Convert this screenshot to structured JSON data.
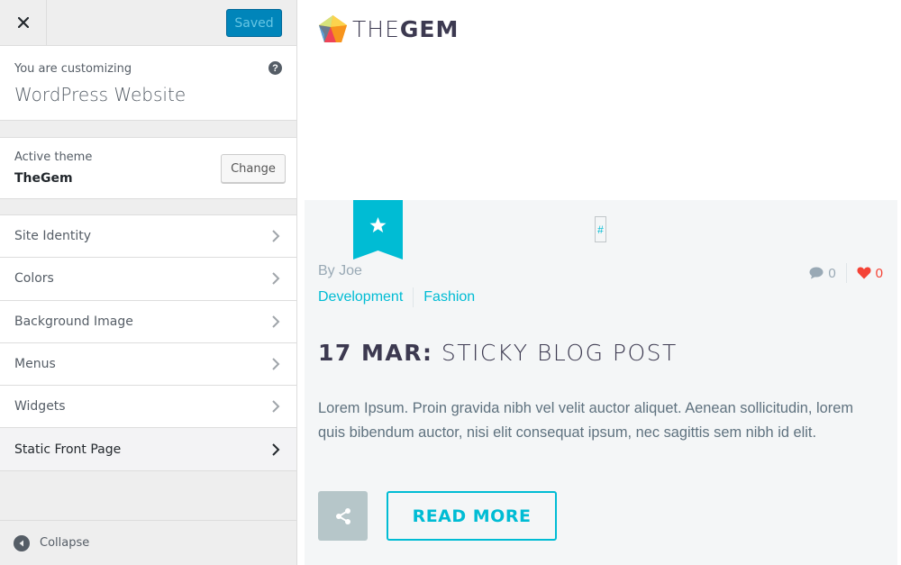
{
  "sidebar": {
    "header": {
      "close_icon": "close-icon",
      "saved_label": "Saved"
    },
    "info": {
      "customizing_label": "You are customizing",
      "site_name": "WordPress Website",
      "help_icon": "help-icon",
      "help_glyph": "?"
    },
    "theme": {
      "label": "Active theme",
      "name": "TheGem",
      "change_label": "Change"
    },
    "items": [
      {
        "label": "Site Identity"
      },
      {
        "label": "Colors"
      },
      {
        "label": "Background Image"
      },
      {
        "label": "Menus"
      },
      {
        "label": "Widgets"
      },
      {
        "label": "Static Front Page",
        "active": true
      }
    ],
    "footer": {
      "collapse_label": "Collapse"
    }
  },
  "preview": {
    "logo": {
      "thin": "THE",
      "bold": "GEM"
    },
    "post": {
      "hash_link": "#",
      "author": "By Joe",
      "categories": [
        "Development",
        "Fashion"
      ],
      "comments_count": "0",
      "likes_count": "0",
      "date": "17 MAR:",
      "title": "STICKY BLOG POST",
      "excerpt": "Lorem Ipsum. Proin gravida nibh vel velit auctor aliquet. Aenean sollicitudin, lorem quis bibendum auctor, nisi elit consequat ipsum, nec sagittis sem nibh id elit.",
      "read_more_label": "READ MORE"
    },
    "colors": {
      "accent": "#00bcd4",
      "like": "#f44336",
      "saved_button": "#0085ba"
    }
  }
}
